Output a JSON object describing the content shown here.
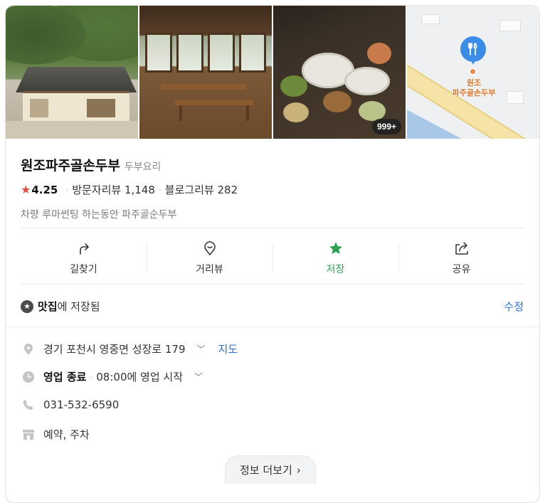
{
  "photos": {
    "count_badge": "999+"
  },
  "map": {
    "pin_label_line1": "원조",
    "pin_label_line2": "파주골손두부"
  },
  "place": {
    "name": "원조파주골손두부",
    "category": "두부요리",
    "rating": "4.25",
    "visitor_reviews": "방문자리뷰 1,148",
    "blog_reviews": "블로그리뷰 282",
    "description": "차량 루마썬팅 하는동안 파주골순두부"
  },
  "actions": [
    {
      "label": "길찾기",
      "icon": "directions-icon"
    },
    {
      "label": "거리뷰",
      "icon": "streetview-pin-icon"
    },
    {
      "label": "저장",
      "icon": "star-icon"
    },
    {
      "label": "공유",
      "icon": "share-icon"
    }
  ],
  "saved": {
    "list_name": "맛집",
    "suffix": "에 저장됨",
    "edit_label": "수정"
  },
  "info": {
    "address": "경기 포천시 영중면 성장로 179",
    "map_link": "지도",
    "hours_status": "영업 종료",
    "hours_next": "08:00에 영업 시작",
    "phone": "031-532-6590",
    "amenities": "예약, 주차"
  },
  "more_button": "정보 더보기",
  "colors": {
    "accent_green": "#2fa153",
    "link_blue": "#2a6fd6",
    "rating_red": "#e24b3d",
    "map_pin": "#3a8ce6"
  }
}
